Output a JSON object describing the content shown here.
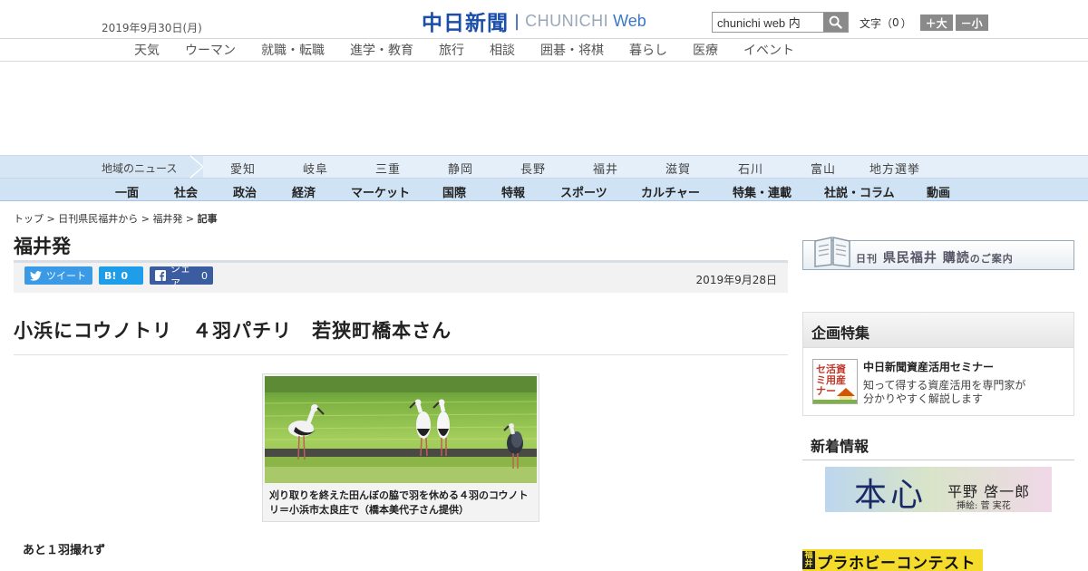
{
  "header": {
    "date": "2019年9月30日(月)",
    "logo_ja": "中日新聞",
    "logo_en": "CHUNICHI",
    "logo_web": "Web",
    "search_value": "chunichi web 内",
    "font_label": "文字（",
    "font_count": "0",
    "font_close": "）",
    "font_larger": "＋大",
    "font_smaller": "－小"
  },
  "subnav": [
    "天気",
    "ウーマン",
    "就職・転職",
    "進学・教育",
    "旅行",
    "相談",
    "囲碁・将棋",
    "暮らし",
    "医療",
    "イベント"
  ],
  "region": {
    "label": "地域のニュース",
    "items": [
      "愛知",
      "岐阜",
      "三重",
      "静岡",
      "長野",
      "福井",
      "滋賀",
      "石川",
      "富山",
      "地方選挙"
    ]
  },
  "categories": [
    "一面",
    "社会",
    "政治",
    "経済",
    "マーケット",
    "国際",
    "特報",
    "スポーツ",
    "カルチャー",
    "特集・連載",
    "社説・コラム",
    "動画"
  ],
  "breadcrumb": {
    "top": "トップ",
    "sep": " > ",
    "level1": "日刊県民福井から",
    "level2": "福井発",
    "current": "記事"
  },
  "section_title": "福井発",
  "share": {
    "tweet": "ツイート",
    "hatena": "B!",
    "hatena_count": "0",
    "facebook": "シェア",
    "facebook_count": "0"
  },
  "publish_date": "2019年9月28日",
  "article": {
    "headline": "小浜にコウノトリ　４羽パチリ　若狭町橋本さん",
    "caption": "刈り取りを終えた田んぼの脇で羽を休める４羽のコウノトリ＝小浜市太良庄で（橋本美代子さん提供）",
    "subheading": "あと１羽撮れず"
  },
  "sidebar": {
    "promo_small_1": "日刊",
    "promo_main_1": "県民福井",
    "promo_main_2": "購読",
    "promo_small_2": "のご案内",
    "feature_heading": "企画特集",
    "feature_thumb_text": "資産活用セミナー",
    "feature_title": "中日新聞資産活用セミナー",
    "feature_desc_1": "知って得する資産活用を専門家が",
    "feature_desc_2": "分かりやすく解説します",
    "news_heading": "新着情報",
    "novel_title": "本心",
    "novel_author": "平野 啓一郎",
    "novel_illustrator": "挿絵: 菅 実花",
    "contest_mark": "福井",
    "contest_text": "プラホビーコンテスト"
  },
  "colors": {
    "brand_blue": "#1a4ea8",
    "tweet_blue": "#3a9ae6",
    "hatena_blue": "#1e9de8",
    "facebook_blue": "#3b5c9f",
    "nav_blue": "#cfe3f5",
    "contest_yellow": "#f5dc2a"
  }
}
